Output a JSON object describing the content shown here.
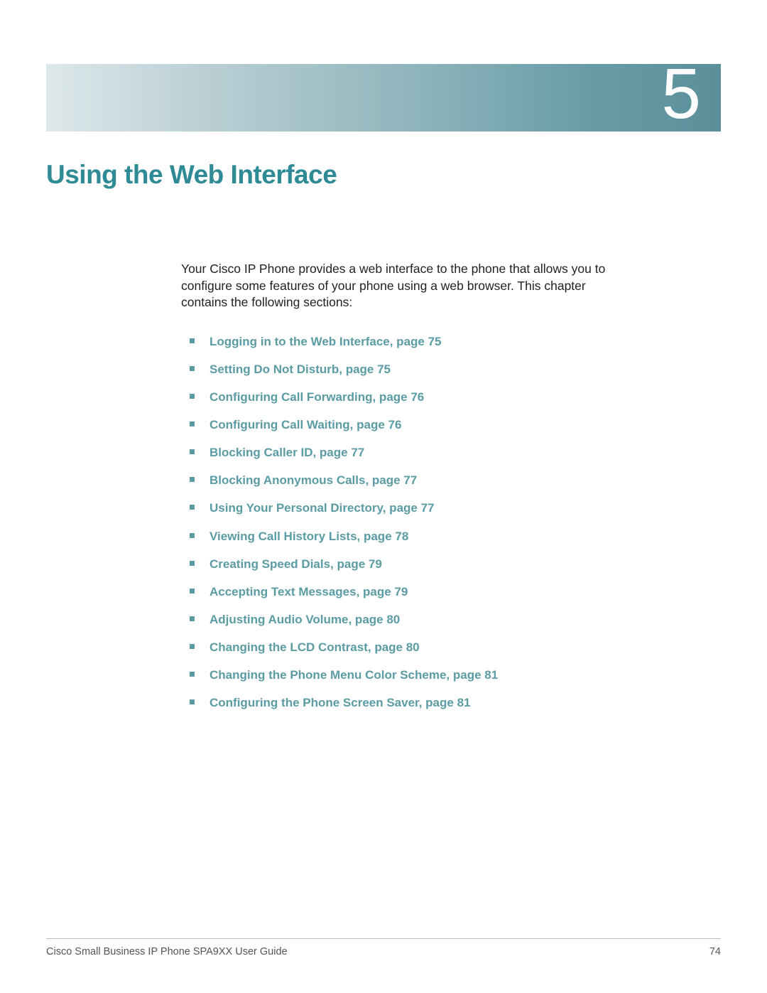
{
  "chapter": {
    "number": "5",
    "title": "Using the Web Interface"
  },
  "intro": "Your Cisco IP Phone provides a web interface to the phone that allows you to configure some features of your phone using a web browser. This chapter contains the following sections:",
  "toc": [
    "Logging in to the Web Interface, page 75",
    "Setting Do Not Disturb, page 75",
    "Configuring Call Forwarding, page 76",
    "Configuring Call Waiting, page 76",
    "Blocking Caller ID, page 77",
    "Blocking Anonymous Calls, page 77",
    "Using Your Personal Directory, page 77",
    "Viewing Call History Lists, page 78",
    "Creating Speed Dials, page 79",
    "Accepting Text Messages, page 79",
    "Adjusting Audio Volume, page 80",
    "Changing the LCD Contrast, page 80",
    "Changing the Phone Menu Color Scheme, page 81",
    "Configuring the Phone Screen Saver, page 81"
  ],
  "footer": {
    "left": "Cisco Small Business IP Phone SPA9XX User Guide",
    "right": "74"
  }
}
